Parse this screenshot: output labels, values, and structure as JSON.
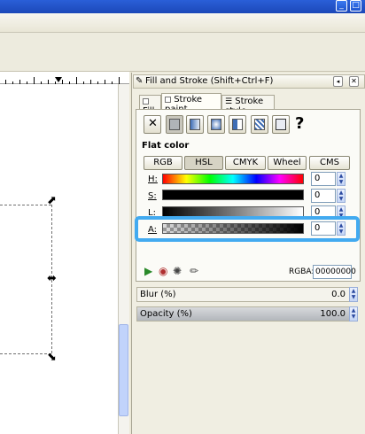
{
  "window": {
    "minimize_label": "_",
    "maximize_label": "□"
  },
  "dock": {
    "title": "Fill and Stroke (Shift+Ctrl+F)",
    "tabs": [
      {
        "label": "Fill"
      },
      {
        "label": "Stroke paint"
      },
      {
        "label": "Stroke style"
      }
    ],
    "paint_type_buttons": [
      "no-paint",
      "flat-color",
      "linear-gradient",
      "radial-gradient",
      "pattern",
      "swatch",
      "unset"
    ],
    "unset_glyph": "?",
    "none_glyph": "✕",
    "section_title": "Flat color",
    "color_modes": [
      "RGB",
      "HSL",
      "CMYK",
      "Wheel",
      "CMS"
    ],
    "selected_mode": "HSL",
    "sliders": [
      {
        "label": "H:",
        "value": "0"
      },
      {
        "label": "S:",
        "value": "0"
      },
      {
        "label": "L:",
        "value": "0"
      },
      {
        "label": "A:",
        "value": "0"
      }
    ],
    "rgba_label": "RGBA:",
    "rgba_value": "00000000",
    "blur_label": "Blur (%)",
    "blur_value": "0.0",
    "opacity_label": "Opacity (%)",
    "opacity_value": "100.0"
  },
  "colors": {
    "highlight": "#42aaf0",
    "titlebar": "#245edb"
  }
}
